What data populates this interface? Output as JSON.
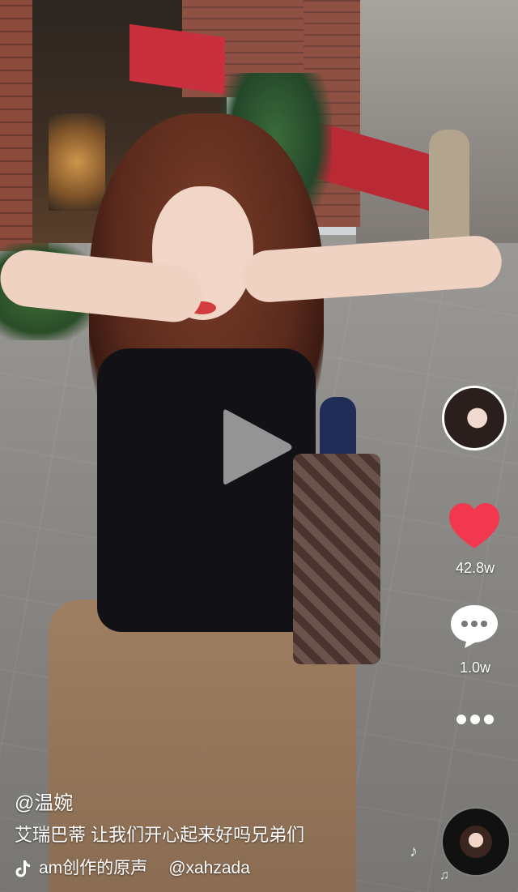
{
  "video": {
    "play_button": "play-icon"
  },
  "side_actions": {
    "avatar": "creator-avatar",
    "like_icon": "heart-icon",
    "like_color": "#f2384f",
    "like_count": "42.8w",
    "comment_icon": "comment-icon",
    "comment_count": "1.0w",
    "more_icon": "more-icon"
  },
  "caption": {
    "username": "@温婉",
    "description": "艾瑞巴蒂 让我们开心起来好吗兄弟们",
    "music_icon": "tiktok-icon",
    "music_title": "am创作的原声",
    "music_author": "@xahzada"
  },
  "music_disc": {
    "icon": "music-disc-icon",
    "note_icon": "music-note-icon"
  }
}
